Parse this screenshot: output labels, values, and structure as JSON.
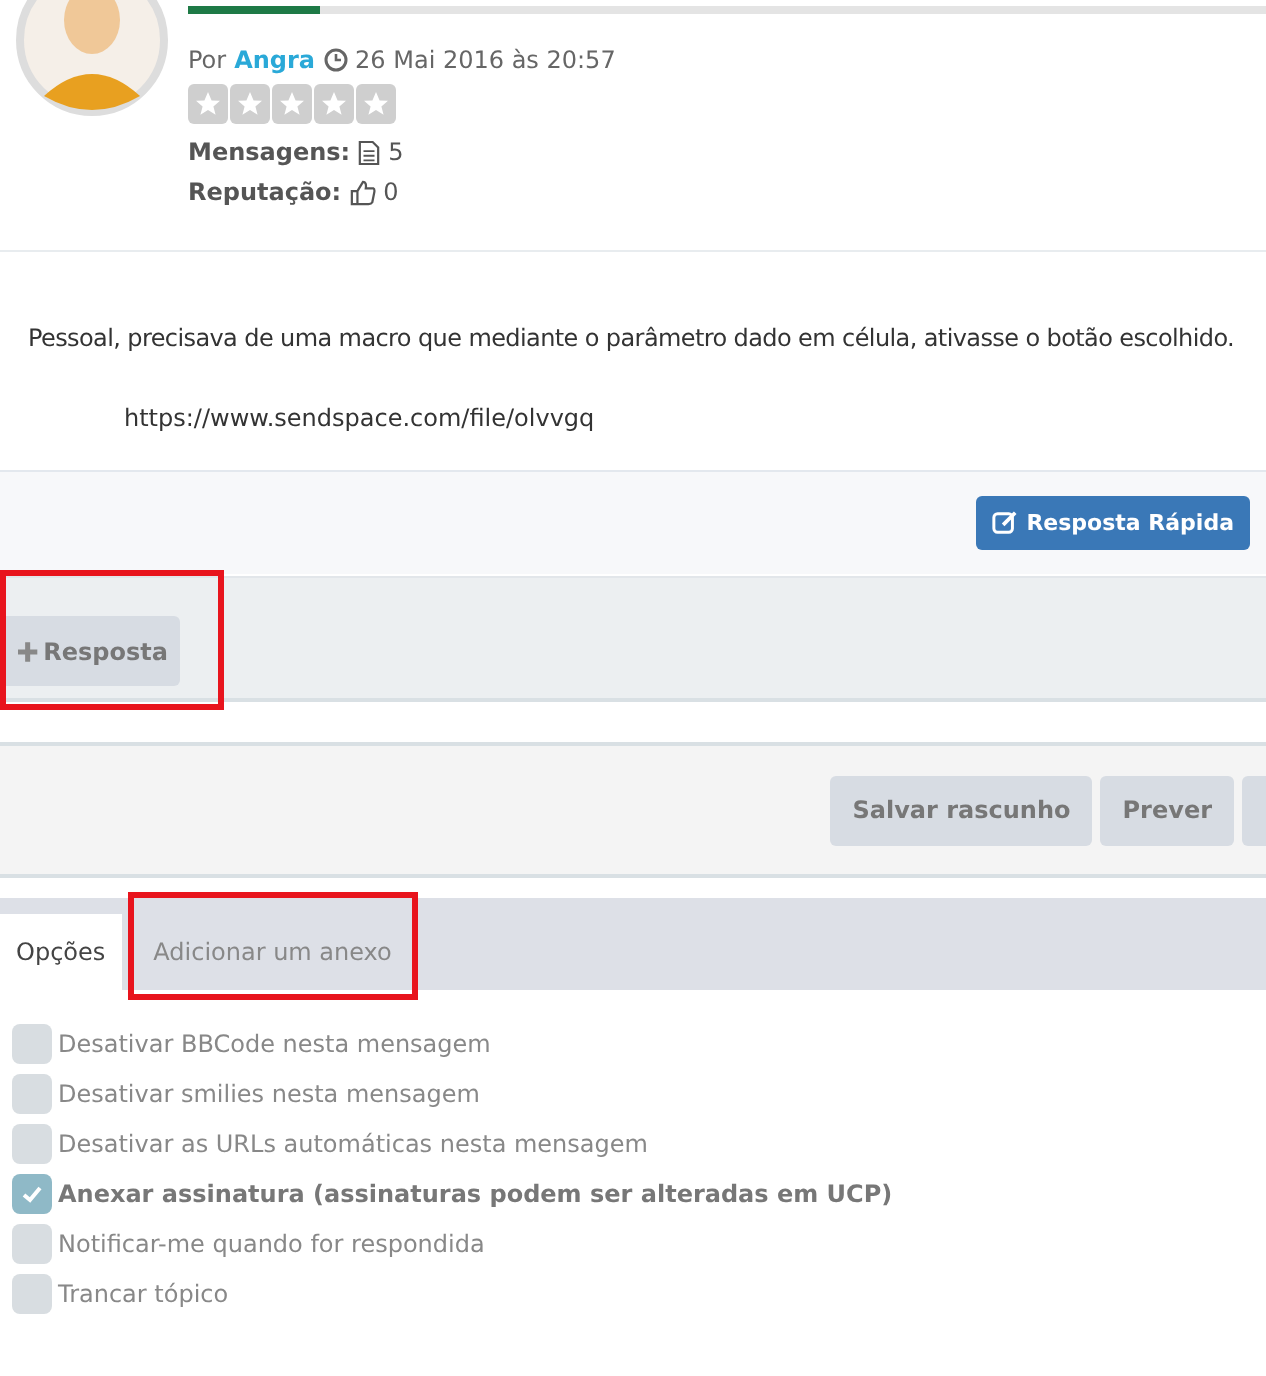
{
  "post": {
    "by_label": "Por",
    "author": "Angra",
    "date": "26 Mai 2016 às 20:57",
    "stars": 0,
    "stats": [
      {
        "label": "Mensagens:",
        "kind": "posts",
        "value": "5"
      },
      {
        "label": "Reputação:",
        "kind": "reputation",
        "value": "0"
      }
    ],
    "body": "Pessoal, precisava de uma macro que mediante o parâmetro dado em célula, ativasse o botão escolhido.",
    "link": "https://www.sendspace.com/file/olvvgq",
    "quick_reply": "Resposta Rápida"
  },
  "reply_button": {
    "label": "Resposta",
    "highlighted": true
  },
  "form_buttons": [
    "Salvar rascunho",
    "Prever"
  ],
  "tabs": [
    {
      "label": "Opções",
      "selected": true,
      "highlighted": false
    },
    {
      "label": "Adicionar um anexo",
      "selected": false,
      "highlighted": true
    }
  ],
  "options": [
    {
      "label": "Desativar BBCode nesta mensagem",
      "checked": false
    },
    {
      "label": "Desativar smilies nesta mensagem",
      "checked": false
    },
    {
      "label": "Desativar as URLs automáticas nesta mensagem",
      "checked": false
    },
    {
      "label": "Anexar assinatura (assinaturas podem ser alteradas em UCP)",
      "checked": true
    },
    {
      "label": "Notificar-me quando for respondida",
      "checked": false
    },
    {
      "label": "Trancar tópico",
      "checked": false
    }
  ]
}
